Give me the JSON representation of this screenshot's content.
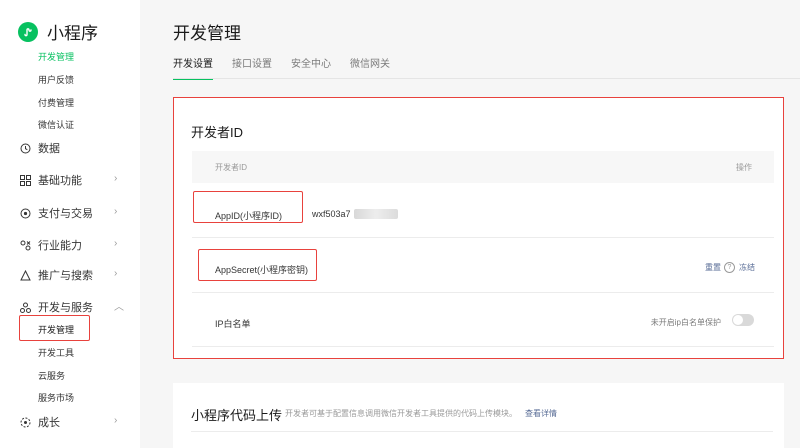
{
  "brand": {
    "name": "小程序",
    "accent": "#07c160"
  },
  "sidebar": {
    "top_items": [
      "开发管理",
      "用户反馈",
      "付费管理",
      "微信认证"
    ],
    "groups": [
      {
        "label": "数据",
        "icon": "clock-icon"
      },
      {
        "label": "基础功能",
        "icon": "grid-icon"
      },
      {
        "label": "支付与交易",
        "icon": "payment-icon"
      },
      {
        "label": "行业能力",
        "icon": "industry-icon"
      },
      {
        "label": "推广与搜索",
        "icon": "promote-icon"
      },
      {
        "label": "开发与服务",
        "icon": "dev-service-icon"
      },
      {
        "label": "成长",
        "icon": "growth-icon"
      }
    ],
    "dev_sub_items": [
      "开发管理",
      "开发工具",
      "云服务",
      "服务市场"
    ],
    "chevron_right": "›",
    "chevron_up": "︿"
  },
  "page": {
    "title": "开发管理"
  },
  "tabs": [
    "开发设置",
    "接口设置",
    "安全中心",
    "微信网关"
  ],
  "developer_id": {
    "title": "开发者ID",
    "header_left": "开发者ID",
    "header_right": "操作",
    "appid_label": "AppID(小程序ID)",
    "appid_value": "wxf503a7",
    "secret_label": "AppSecret(小程序密钥)",
    "view_link": "重置",
    "help": "?",
    "freeze_link": "冻结",
    "ip_label": "IP白名单",
    "ip_status": "未开启ip白名单保护",
    "ip_enabled": false
  },
  "upload": {
    "title": "小程序代码上传",
    "desc": "开发者可基于配置信息调用微信开发者工具提供的代码上传模块。",
    "link": "查看详情"
  },
  "colors": {
    "highlight": "#e8423d",
    "link": "#576b95"
  }
}
